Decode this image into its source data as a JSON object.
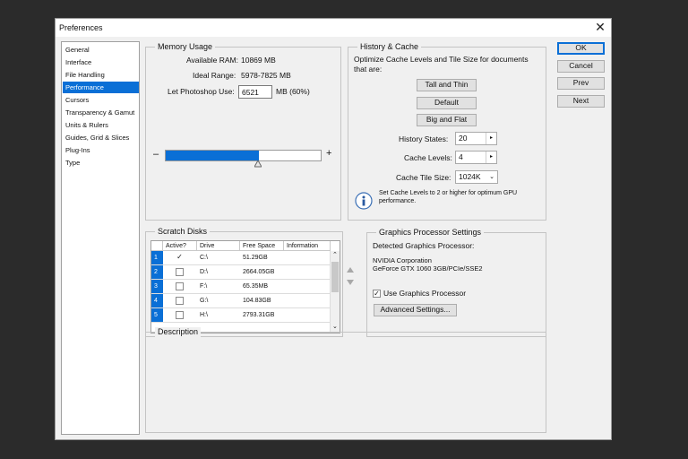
{
  "window": {
    "title": "Preferences",
    "close_glyph": "✕"
  },
  "nav": {
    "items": [
      "General",
      "Interface",
      "File Handling",
      "Performance",
      "Cursors",
      "Transparency & Gamut",
      "Units & Rulers",
      "Guides, Grid & Slices",
      "Plug-Ins",
      "Type"
    ],
    "selected_index": 3
  },
  "buttons": {
    "ok": "OK",
    "cancel": "Cancel",
    "prev": "Prev",
    "next": "Next"
  },
  "memory": {
    "title": "Memory Usage",
    "available_label": "Available RAM:",
    "available_value": "10869 MB",
    "ideal_label": "Ideal Range:",
    "ideal_value": "5978-7825 MB",
    "let_label": "Let Photoshop Use:",
    "let_value": "6521",
    "let_suffix": "MB (60%)",
    "minus": "–",
    "plus": "+",
    "slider_fraction": 0.6
  },
  "history": {
    "title": "History & Cache",
    "description": "Optimize Cache Levels and Tile Size for documents that are:",
    "btn_tall": "Tall and Thin",
    "btn_default": "Default",
    "btn_big": "Big and Flat",
    "states_label": "History States:",
    "states_value": "20",
    "levels_label": "Cache Levels:",
    "levels_value": "4",
    "tile_label": "Cache Tile Size:",
    "tile_value": "1024K",
    "info_text": "Set Cache Levels to 2 or higher for optimum GPU performance."
  },
  "scratch": {
    "title": "Scratch Disks",
    "columns": [
      "Active?",
      "Drive",
      "Free Space",
      "Information"
    ],
    "rows": [
      {
        "num": "1",
        "active": "✓",
        "drive": "C:\\",
        "free": "51.29GB"
      },
      {
        "num": "2",
        "active": "",
        "drive": "D:\\",
        "free": "2664.05GB"
      },
      {
        "num": "3",
        "active": "",
        "drive": "F:\\",
        "free": "65.35MB"
      },
      {
        "num": "4",
        "active": "",
        "drive": "G:\\",
        "free": "104.83GB"
      },
      {
        "num": "5",
        "active": "",
        "drive": "H:\\",
        "free": "2793.31GB"
      }
    ]
  },
  "gpu": {
    "title": "Graphics Processor Settings",
    "detected_label": "Detected Graphics Processor:",
    "vendor": "NVIDIA Corporation",
    "model": "GeForce GTX 1060 3GB/PCIe/SSE2",
    "use_label": "Use Graphics Processor",
    "use_checked": "✓",
    "advanced": "Advanced Settings..."
  },
  "description": {
    "title": "Description"
  }
}
